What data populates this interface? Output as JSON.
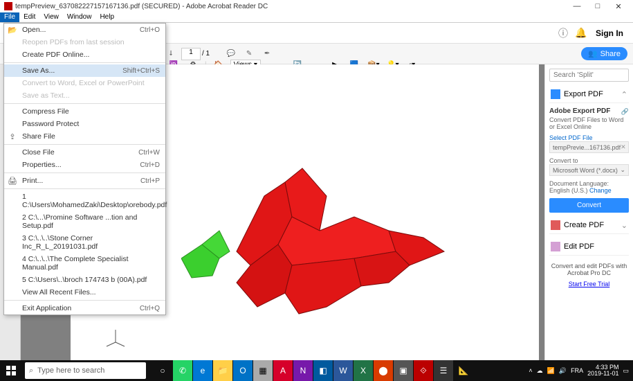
{
  "title": "tempPreview_637082227157167136.pdf (SECURED) - Adobe Acrobat Reader DC",
  "windowButtons": {
    "min": "—",
    "max": "□",
    "close": "✕"
  },
  "menubar": [
    "File",
    "Edit",
    "View",
    "Window",
    "Help"
  ],
  "fileMenu": {
    "open": {
      "label": "Open...",
      "shortcut": "Ctrl+O"
    },
    "reopen": "Reopen PDFs from last session",
    "createOnline": "Create PDF Online...",
    "saveAs": {
      "label": "Save As...",
      "shortcut": "Shift+Ctrl+S"
    },
    "convertTo": "Convert to Word, Excel or PowerPoint",
    "saveAsText": "Save as Text...",
    "compress": "Compress File",
    "passwordProtect": "Password Protect",
    "shareFile": "Share File",
    "closeFile": {
      "label": "Close File",
      "shortcut": "Ctrl+W"
    },
    "properties": {
      "label": "Properties...",
      "shortcut": "Ctrl+D"
    },
    "print": {
      "label": "Print...",
      "shortcut": "Ctrl+P"
    },
    "recent": [
      "1 C:\\Users\\MohamedZaki\\Desktop\\orebody.pdf",
      "2 C:\\...\\Promine Software ...tion and Setup.pdf",
      "3 C:\\..\\..\\Stone Corner Inc_R_L_20191031.pdf",
      "4 C:\\..\\..\\The Complete Specialist Manual.pdf",
      "5 C:\\Users\\..\\broch 174743 b (00A).pdf"
    ],
    "viewAllRecent": "View All Recent Files...",
    "exit": {
      "label": "Exit Application",
      "shortcut": "Ctrl+Q"
    }
  },
  "chrome": {
    "signin": "Sign In"
  },
  "toolbar": {
    "page": "1",
    "pages": "/ 1",
    "share": "Share",
    "viewsLabel": "Views"
  },
  "rightPanel": {
    "searchPlaceholder": "Search 'Split'",
    "exportPDF": "Export PDF",
    "exportCard": {
      "title": "Adobe Export PDF",
      "sub": "Convert PDF Files to Word or Excel Online",
      "selectLabel": "Select PDF File",
      "file": "tempPrevie...167136.pdf",
      "convertToLabel": "Convert to",
      "format": "Microsoft Word (*.docx)",
      "langLabel": "Document Language:",
      "lang": "English (U.S.)",
      "change": "Change",
      "btn": "Convert"
    },
    "createPDF": "Create PDF",
    "editPDF": "Edit PDF",
    "promo": "Convert and edit PDFs with Acrobat Pro DC",
    "trial": "Start Free Trial"
  },
  "taskbar": {
    "search": "Type here to search",
    "lang": "FRA",
    "time": "4:33 PM",
    "date": "2019-11-01"
  }
}
